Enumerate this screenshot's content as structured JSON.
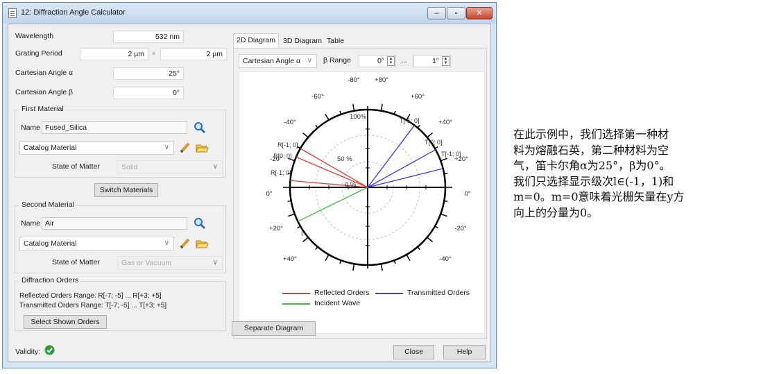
{
  "window": {
    "title": "12: Diffraction Angle Calculator",
    "controls": {
      "minimize": "–",
      "maximize": "▫",
      "close": "✕"
    }
  },
  "params": {
    "wavelength": {
      "label": "Wavelength",
      "value": "532 nm"
    },
    "grating_period": {
      "label": "Grating Period",
      "value_x": "2 µm",
      "times": "×",
      "value_y": "2 µm"
    },
    "angle_alpha": {
      "label": "Cartesian Angle α",
      "value": "25°"
    },
    "angle_beta": {
      "label": "Cartesian Angle β",
      "value": "0°"
    }
  },
  "first_material": {
    "group": "First Material",
    "name_label": "Name",
    "name": "Fused_Silica",
    "type": "Catalog Material",
    "state_label": "State of Matter",
    "state": "Solid"
  },
  "switch_button": "Switch Materials",
  "second_material": {
    "group": "Second Material",
    "name_label": "Name",
    "name": "Air",
    "type": "Catalog Material",
    "state_label": "State of Matter",
    "state": "Gas or Vacuum"
  },
  "diffraction_orders": {
    "group": "Diffraction Orders",
    "reflected": "Reflected Orders Range: R[-7; -5] ... R[+3; +5]",
    "transmitted": "Transmitted Orders Range: T[-7; -5] ... T[+3; +5]",
    "select_button": "Select Shown Orders"
  },
  "validity": {
    "label": "Validity:",
    "status": "valid",
    "color": "#2e9d3a"
  },
  "tabs": [
    {
      "label": "2D Diagram",
      "active": true
    },
    {
      "label": "3D Diagram",
      "active": false
    },
    {
      "label": "Table",
      "active": false
    }
  ],
  "diagram_controls": {
    "mode": "Cartesian Angle α",
    "range_label": "β Range",
    "range_from": "0°",
    "range_sep": "...",
    "range_to": "1°"
  },
  "polar": {
    "angle_labels": [
      "-80°",
      "+80°",
      "-60°",
      "+60°",
      "-40°",
      "+40°",
      "-20°",
      "+20°",
      "0°",
      "0°",
      "+20°",
      "-20°",
      "+40°",
      "-40°",
      "+60°",
      "-60°",
      "+80°",
      "-80°"
    ],
    "radial_labels": [
      "100%",
      "50 %",
      "0 %"
    ],
    "order_labels": [
      "T[-1; 0]",
      "T[0; 0]",
      "T[-1; 0]",
      "R[-1; 0]",
      "R[0; 0]",
      "R[-1; 0]",
      "I"
    ],
    "colors": {
      "reflected": "#e53935",
      "transmitted": "#3a3ae0",
      "incident": "#3cbf3c"
    }
  },
  "legend": {
    "reflected": "Reflected Orders",
    "transmitted": "Transmitted Orders",
    "incident": "Incident Wave"
  },
  "separate_button": "Separate Diagram",
  "close_button": "Close",
  "help_button": "Help",
  "annotation": [
    "在此示例中，我们选择第一种材",
    "料为熔融石英，第二种材料为空",
    "气，笛卡尔角α为25°，β为0°。",
    "我们只选择显示级次l∈(-1，1)和",
    "m=0。m=0意味着光栅矢量在y方",
    "向上的分量为0。"
  ]
}
